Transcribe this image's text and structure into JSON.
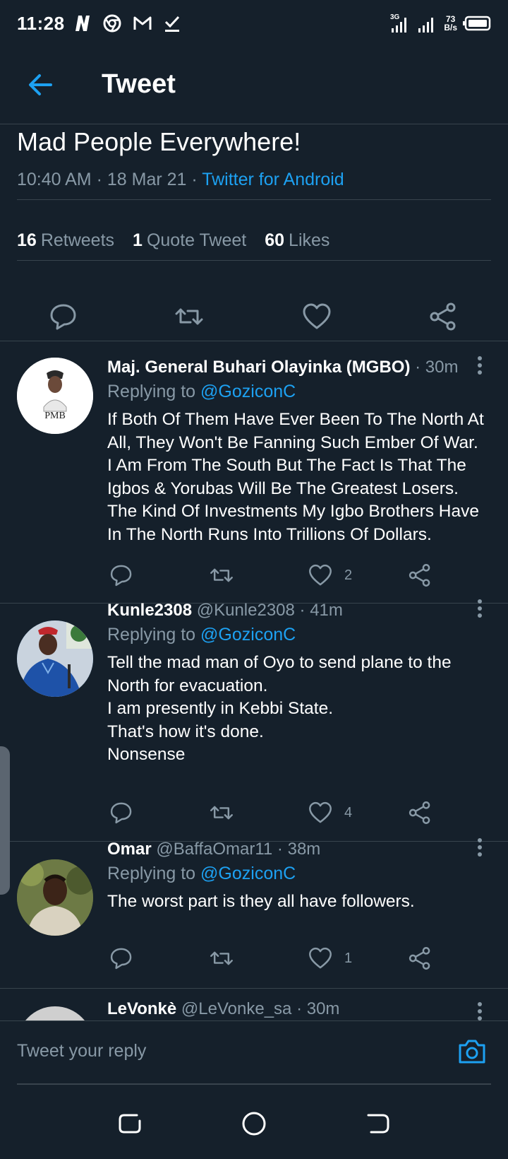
{
  "status_bar": {
    "time": "11:28",
    "network": "3G",
    "netspeed_value": "73",
    "netspeed_unit": "B/s"
  },
  "header": {
    "title": "Tweet"
  },
  "tweet": {
    "text": "Mad People Everywhere!",
    "time": "10:40 AM",
    "date": "18 Mar 21",
    "source": "Twitter for Android",
    "stats": {
      "retweets_count": "16",
      "retweets_label": "Retweets",
      "quotes_count": "1",
      "quotes_label": "Quote Tweet",
      "likes_count": "60",
      "likes_label": "Likes"
    }
  },
  "replies": [
    {
      "name": "Maj. General Buhari Olayinka (MGBO)",
      "handle": "",
      "time": "30m",
      "replying_label": "Replying to",
      "replying_to": "@GoziconC",
      "text": "If Both Of Them Have Ever Been To The North At All, They Won't Be Fanning Such Ember Of War.\nI Am From The South But The Fact Is That The Igbos & Yorubas Will Be The Greatest Losers.\nThe Kind Of Investments My Igbo Brothers Have In The North Runs Into Trillions Of Dollars.",
      "likes": "2",
      "avatar_text": "PMB"
    },
    {
      "name": "Kunle2308",
      "handle": "@Kunle2308",
      "time": "41m",
      "replying_label": "Replying to",
      "replying_to": "@GoziconC",
      "text": "Tell the mad man of Oyo to send plane to the North for evacuation.\nI am presently in Kebbi State.\nThat's how it's done.\nNonsense",
      "likes": "4"
    },
    {
      "name": "Omar",
      "handle": "@BaffaOmar11",
      "time": "38m",
      "replying_label": "Replying to",
      "replying_to": "@GoziconC",
      "text": "The worst part is they all have followers.",
      "likes": "1"
    },
    {
      "name": "LeVonkè",
      "handle": "@LeVonke_sa",
      "time": "30m"
    }
  ],
  "composer": {
    "placeholder": "Tweet your reply"
  },
  "colors": {
    "background": "#15202b",
    "accent": "#1da1f2",
    "secondary_text": "#8899a6",
    "divider": "#38444d"
  }
}
